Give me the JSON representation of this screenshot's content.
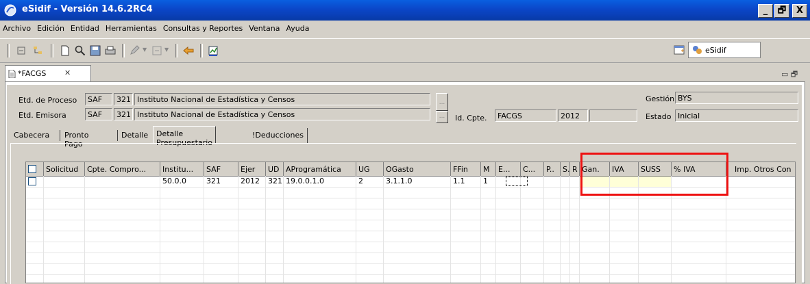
{
  "window": {
    "title": "eSidif - Versión 14.6.2RC4",
    "min": "_",
    "max": "🗗",
    "close": "X"
  },
  "menu": [
    "Archivo",
    "Edición",
    "Entidad",
    "Herramientas",
    "Consultas y Reportes",
    "Ventana",
    "Ayuda"
  ],
  "perspective": {
    "label": "eSidif"
  },
  "editor": {
    "tab_label": "*FACGS",
    "close_glyph": "✕",
    "minmax": "▭ 🗗"
  },
  "form": {
    "etd_proceso": {
      "label": "Etd. de Proceso",
      "tipo": "SAF",
      "codigo": "321",
      "nombre": "Instituto Nacional de Estadística y Censos"
    },
    "etd_emisora": {
      "label": "Etd. Emisora",
      "tipo": "SAF",
      "codigo": "321",
      "nombre": "Instituto Nacional de Estadística y Censos"
    },
    "id_cpte": {
      "label": "Id. Cpte.",
      "tipo": "FACGS",
      "anio": "2012",
      "numero": ""
    },
    "gestion": {
      "label": "Gestión",
      "value": "BYS"
    },
    "estado": {
      "label": "Estado",
      "value": "Inicial"
    },
    "ellipsis": "..."
  },
  "tabs": [
    "Cabecera",
    "Pronto Pago",
    "Detalle",
    "Detalle Presupuestario",
    "!Deducciones"
  ],
  "table": {
    "columns": [
      "",
      "Solicitud",
      "Cpte. Compro...",
      "Institu...",
      "SAF",
      "Ejer",
      "UD",
      "AProgramática",
      "UG",
      "OGasto",
      "FFin",
      "M",
      "E...",
      "C...",
      "P..",
      "S.",
      "R",
      "Gan.",
      "IVA",
      "SUSS",
      "% IVA",
      "Imp. Otros Con"
    ],
    "rows": [
      [
        "",
        "",
        "",
        "50.0.0",
        "321",
        "2012",
        "321",
        "19.0.0.1.0",
        "2",
        "3.1.1.0",
        "1.1",
        "1",
        "",
        "",
        "",
        "",
        "",
        "",
        "",
        "",
        "",
        ""
      ]
    ]
  },
  "highlight_color": "#ee1111"
}
